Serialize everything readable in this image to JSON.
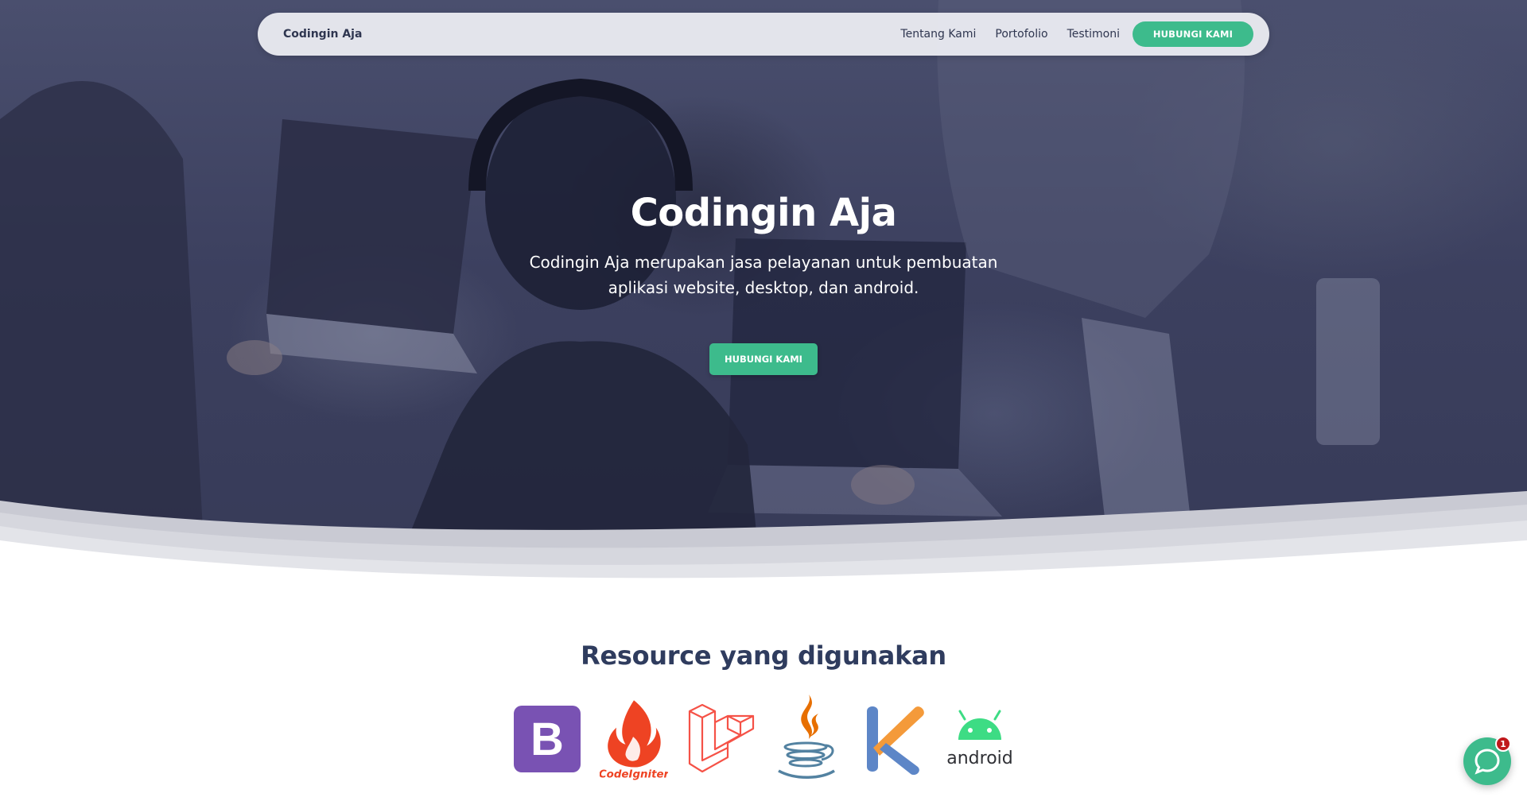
{
  "navbar": {
    "brand": "Codingin Aja",
    "links": [
      "Tentang Kami",
      "Portofolio",
      "Testimoni"
    ],
    "cta": "HUBUNGI KAMI"
  },
  "hero": {
    "title": "Codingin Aja",
    "description": "Codingin Aja merupakan jasa pelayanan untuk pembuatan aplikasi website, desktop, dan android.",
    "cta": "HUBUNGI KAMI"
  },
  "resources": {
    "title": "Resource yang digunakan",
    "logos": [
      {
        "icon": "bootstrap-icon",
        "label": "B"
      },
      {
        "icon": "codeigniter-icon",
        "label": "CodeIgniter"
      },
      {
        "icon": "laravel-icon",
        "label": ""
      },
      {
        "icon": "java-icon",
        "label": ""
      },
      {
        "icon": "kotlin-icon",
        "label": ""
      },
      {
        "icon": "android-icon",
        "label": "android"
      }
    ]
  },
  "chat": {
    "badge_count": "1"
  },
  "colors": {
    "accent": "#3dbb8c",
    "navy": "#2f3c5e",
    "hero_overlay": "#3c405f"
  }
}
